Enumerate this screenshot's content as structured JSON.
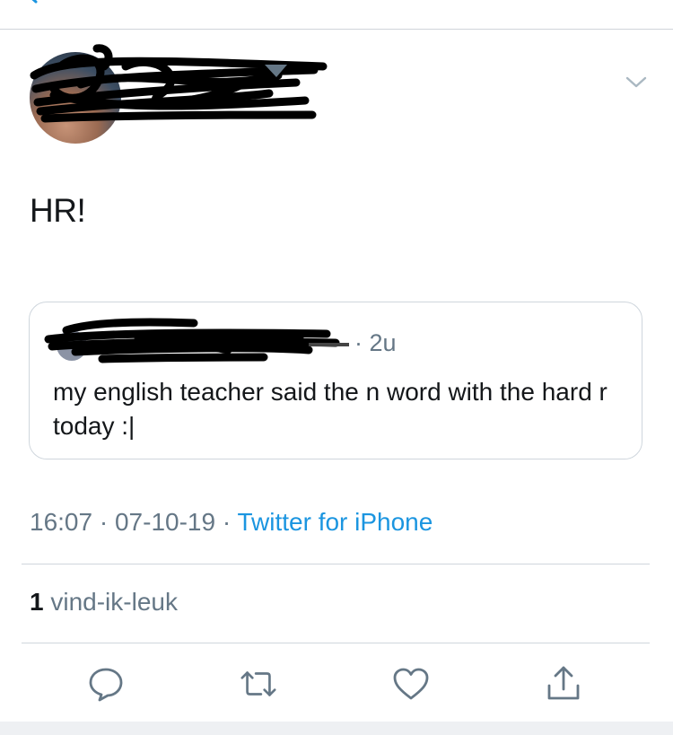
{
  "tweet": {
    "text": "HR!"
  },
  "quoted_tweet": {
    "time_ago": "· 2u",
    "text": "my english teacher said the n word with the hard r today :|"
  },
  "meta": {
    "time": "16:07",
    "sep1": " · ",
    "date": "07-10-19",
    "sep2": " · ",
    "source": "Twitter for iPhone"
  },
  "likes": {
    "count": "1",
    "label": "vind-ik-leuk"
  },
  "actions": [
    "reply-icon",
    "retweet-icon",
    "like-icon",
    "share-icon"
  ],
  "colors": {
    "link": "#1b95e0",
    "muted": "#657786",
    "divider": "#cfd6dd",
    "redaction": "#000000"
  }
}
